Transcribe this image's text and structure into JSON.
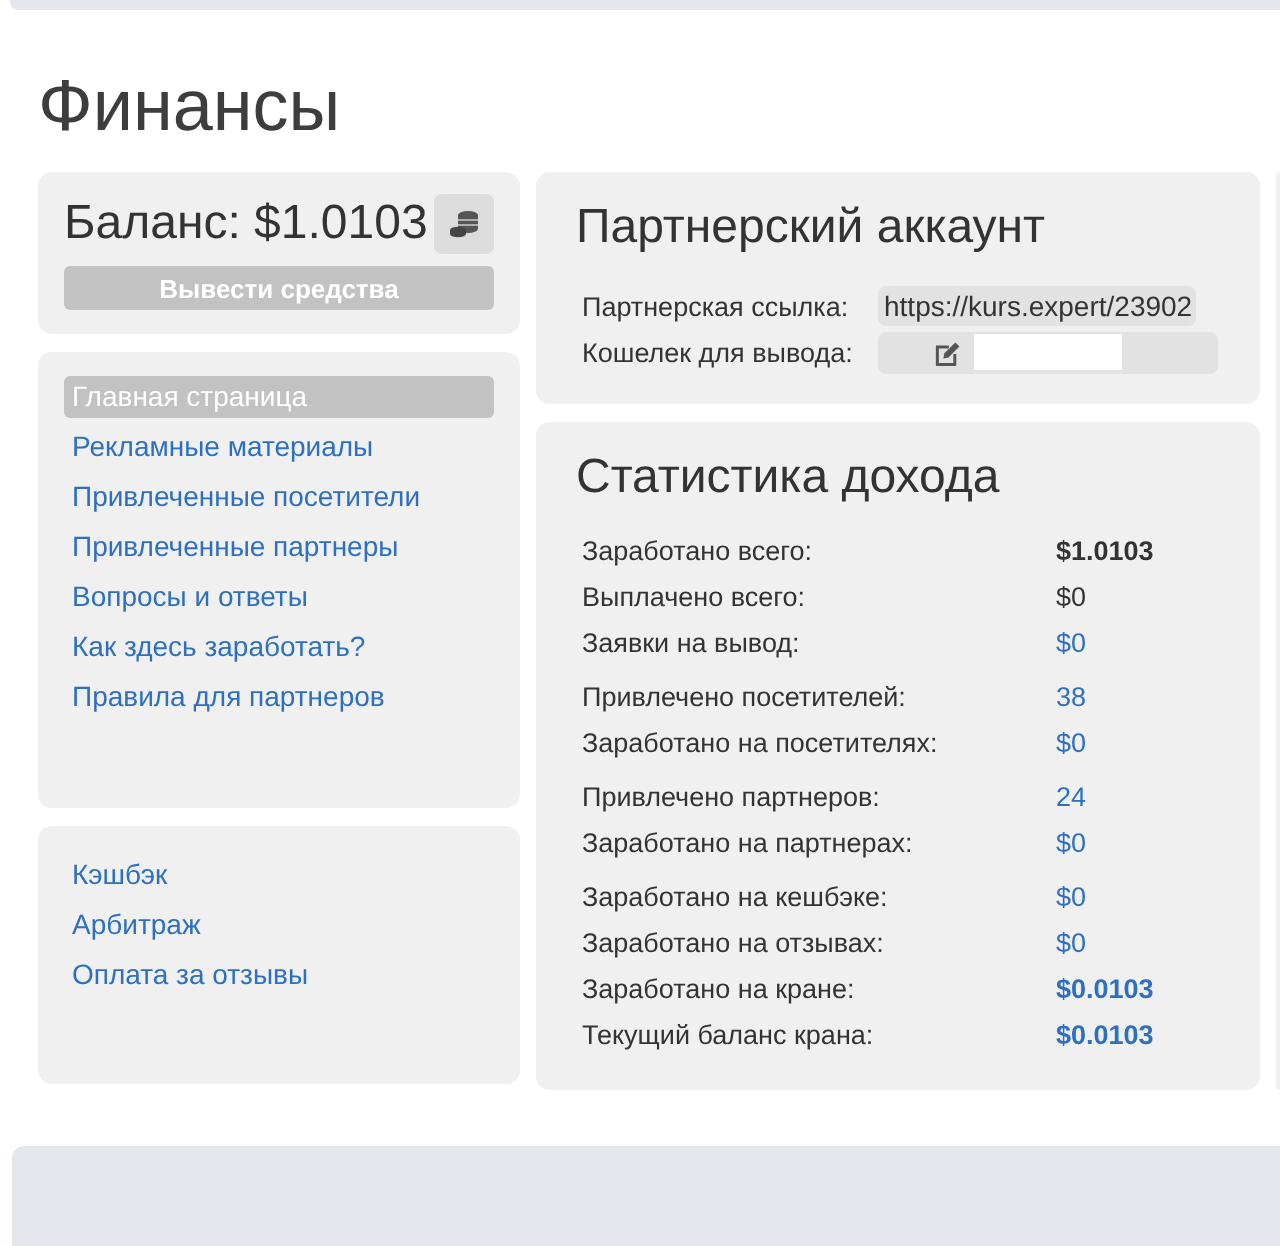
{
  "page_title": "Финансы",
  "balance": {
    "label": "Баланс: $1.0103",
    "withdraw_button": "Вывести средства"
  },
  "nav_main": [
    {
      "label": "Главная страница",
      "selected": true
    },
    {
      "label": "Рекламные материалы",
      "selected": false
    },
    {
      "label": "Привлеченные посетители",
      "selected": false
    },
    {
      "label": "Привлеченные партнеры",
      "selected": false
    },
    {
      "label": "Вопросы и ответы",
      "selected": false
    },
    {
      "label": "Как здесь заработать?",
      "selected": false
    },
    {
      "label": "Правила для партнеров",
      "selected": false
    }
  ],
  "nav_extra": [
    {
      "label": "Кэшбэк",
      "selected": false
    },
    {
      "label": "Арбитраж",
      "selected": false
    },
    {
      "label": "Оплата за отзывы",
      "selected": false
    }
  ],
  "partner_account": {
    "title": "Партнерский аккаунт",
    "link_label": "Партнерская ссылка:",
    "link_value": "https://kurs.expert/23902",
    "wallet_label": "Кошелек для вывода:"
  },
  "income_stats": {
    "title": "Статистика дохода",
    "groups": [
      {
        "rows": [
          {
            "label": "Заработано всего:",
            "value": "$1.0103",
            "bold": true,
            "link": false
          },
          {
            "label": "Выплачено всего:",
            "value": "$0",
            "bold": false,
            "link": false
          },
          {
            "label": "Заявки на вывод:",
            "value": "$0",
            "bold": false,
            "link": true
          }
        ]
      },
      {
        "rows": [
          {
            "label": "Привлечено посетителей:",
            "value": "38",
            "bold": false,
            "link": true
          },
          {
            "label": "Заработано на посетителях:",
            "value": "$0",
            "bold": false,
            "link": true
          }
        ]
      },
      {
        "rows": [
          {
            "label": "Привлечено партнеров:",
            "value": "24",
            "bold": false,
            "link": true
          },
          {
            "label": "Заработано на партнерах:",
            "value": "$0",
            "bold": false,
            "link": true
          }
        ]
      },
      {
        "rows": [
          {
            "label": "Заработано на кешбэке:",
            "value": "$0",
            "bold": false,
            "link": true
          },
          {
            "label": "Заработано на отзывах:",
            "value": "$0",
            "bold": false,
            "link": true
          },
          {
            "label": "Заработано на кране:",
            "value": "$0.0103",
            "bold": true,
            "link": true
          },
          {
            "label": "Текущий баланс крана:",
            "value": "$0.0103",
            "bold": true,
            "link": true
          }
        ]
      }
    ]
  }
}
